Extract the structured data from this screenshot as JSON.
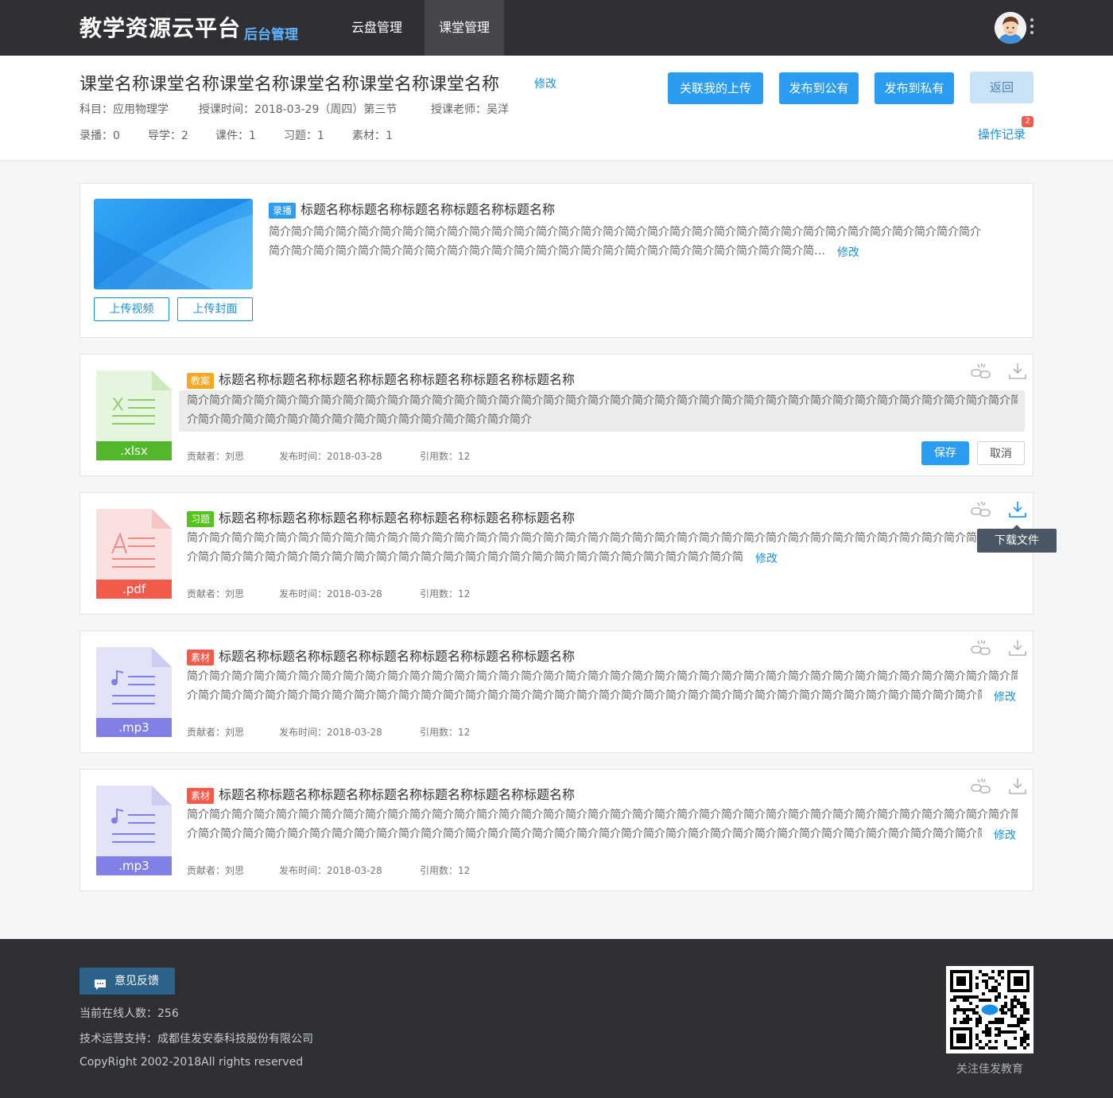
{
  "header": {
    "logo": "教学资源云平台",
    "logo_sub": "后台管理",
    "nav": [
      {
        "label": "云盘管理",
        "active": false
      },
      {
        "label": "课堂管理",
        "active": true
      }
    ]
  },
  "course": {
    "title": "课堂名称课堂名称课堂名称课堂名称课堂名称课堂名称",
    "edit_label": "修改",
    "subject": "科目：应用物理学",
    "time": "授课时间：2018-03-29（周四）第三节",
    "teacher": "授课老师：吴洋",
    "counts": [
      "录播：0",
      "导学：2",
      "课件：1",
      "习题：1",
      "素材：1"
    ]
  },
  "actions": {
    "link_upload": "关联我的上传",
    "publish_public": "发布到公有",
    "publish_private": "发布到私有",
    "back": "返回",
    "op_log": "操作记录",
    "op_log_badge": "2"
  },
  "video": {
    "tag": "录播",
    "title": "标题名称标题名称标题名称标题名称标题名称",
    "desc_line1": "简介简介简介简介简介简介简介简介简介简介简介简介简介简介简介简介简介简介简介简介简介简介简介简介简介简介简介简介简介简介简介简介",
    "desc_line2": "简介简介简介简介简介简介简介简介简介简介简介简介简介简介简介简介简介简介简介简介简介简介简介简介简介简介简介简介简介简介简介简介简介简介简介简介简介简介简介简介简介简介简介简介简介简介简介简介简介简介简介简介简介简介简介简介简介简介简介简介简介简介简介简介简介简介简介简介简介简介简介简介简介简介简介简介简介简介简介简介简介简介简介简介简介简介简介简介简介简介简介简介简介简介简介简介简介简介简介简介简介简介简介简介简介简介简介简介简介简介简介简介简介简介简介简介简介简介。",
    "edit_label": "修改",
    "upload_video": "上传视频",
    "upload_cover": "上传封面"
  },
  "resources": [
    {
      "tag": "教案",
      "tag_color": "#f5a623",
      "title": "标题名称标题名称标题名称标题名称标题名称标题名称标题名称",
      "ext": ".xlsx",
      "desc_line1": "简介简介简介简介简介简介简介简介简介简介简介简介简介简介简介简介简介简介简介简介简介简介简介简介简介简介简介简介简介简介简介简介简介简介简介简介简介简介简介简介简",
      "desc_line2": "介简介简介简介简介简介简介简介简介简介简介简介简介简介简介简介",
      "contributor": "贡献者：刘思",
      "date": "发布时间：2018-03-28",
      "refs": "引用数：12",
      "editing": true,
      "save_label": "保存",
      "cancel_label": "取消"
    },
    {
      "tag": "习题",
      "tag_color": "#52c41a",
      "title": "标题名称标题名称标题名称标题名称标题名称标题名称标题名称",
      "ext": ".pdf",
      "desc_line1": "简介简介简介简介简介简介简介简介简介简介简介简介简介简介简介简介简介简介简介简介简介简介简介简介简介简介简介简介简介简介简介简介简介简介简介简介简介简介简介简介简",
      "desc_line2": "介简介简介简介简介简介简介简介简介简介简介简介简介简介简介简介简介简介简介简介简介简介简介简介简介简介简介简介简介简介简介简介简介简介简介。",
      "edit_label": "修改",
      "contributor": "贡献者：刘思",
      "date": "发布时间：2018-03-28",
      "refs": "引用数：12",
      "tooltip": "下载文件"
    },
    {
      "tag": "素材",
      "tag_color": "#f25a4c",
      "title": "标题名称标题名称标题名称标题名称标题名称标题名称标题名称",
      "ext": ".mp3",
      "desc_line1": "简介简介简介简介简介简介简介简介简介简介简介简介简介简介简介简介简介简介简介简介简介简介简介简介简介简介简介简介简介简介简介简介简介简介简介简介简介简介简介简介简",
      "desc_line2": "介简介简介简介简介简介简介简介简介简介简介简介简介简介简介简介简介简介简介简介简介简介简介简介简介简介简介简介简介简介简介简介简介简介简介简介简介简介简介简介介简...",
      "edit_label": "修改",
      "contributor": "贡献者：刘思",
      "date": "发布时间：2018-03-28",
      "refs": "引用数：12"
    },
    {
      "tag": "素材",
      "tag_color": "#f25a4c",
      "title": "标题名称标题名称标题名称标题名称标题名称标题名称标题名称",
      "ext": ".mp3",
      "desc_line1": "简介简介简介简介简介简介简介简介简介简介简介简介简介简介简介简介简介简介简介简介简介简介简介简介简介简介简介简介简介简介简介简介简介简介简介简介简介简介简介简介简",
      "desc_line2": "介简介简介简介简介简介简介简介简介简介简介简介简介简介简介简介简介简介简介简介简介简介简介简介简介简介简介简介简介简介简介简介简介简介简介简介简介简介简介简介介简...",
      "edit_label": "修改",
      "contributor": "贡献者：刘思",
      "date": "发布时间：2018-03-28",
      "refs": "引用数：12"
    }
  ],
  "footer": {
    "feedback": "意见反馈",
    "online": "当前在线人数：256",
    "support": "技术运营支持：成都佳发安泰科技股份有限公司",
    "copyright": "CopyRight 2002-2018All rights reserved",
    "qr_caption": "关注佳发教育"
  },
  "colors": {
    "accent": "#2c9cf0",
    "header_bg": "#2e3034",
    "xlsx": "#52c41a",
    "pdf": "#f25a4c",
    "mp3": "#8080e6"
  },
  "icons": [
    "avatar",
    "more-vertical-icon",
    "link-icon",
    "download-icon",
    "xlsx-file-icon",
    "pdf-file-icon",
    "mp3-file-icon",
    "chat-icon",
    "qr-code"
  ]
}
